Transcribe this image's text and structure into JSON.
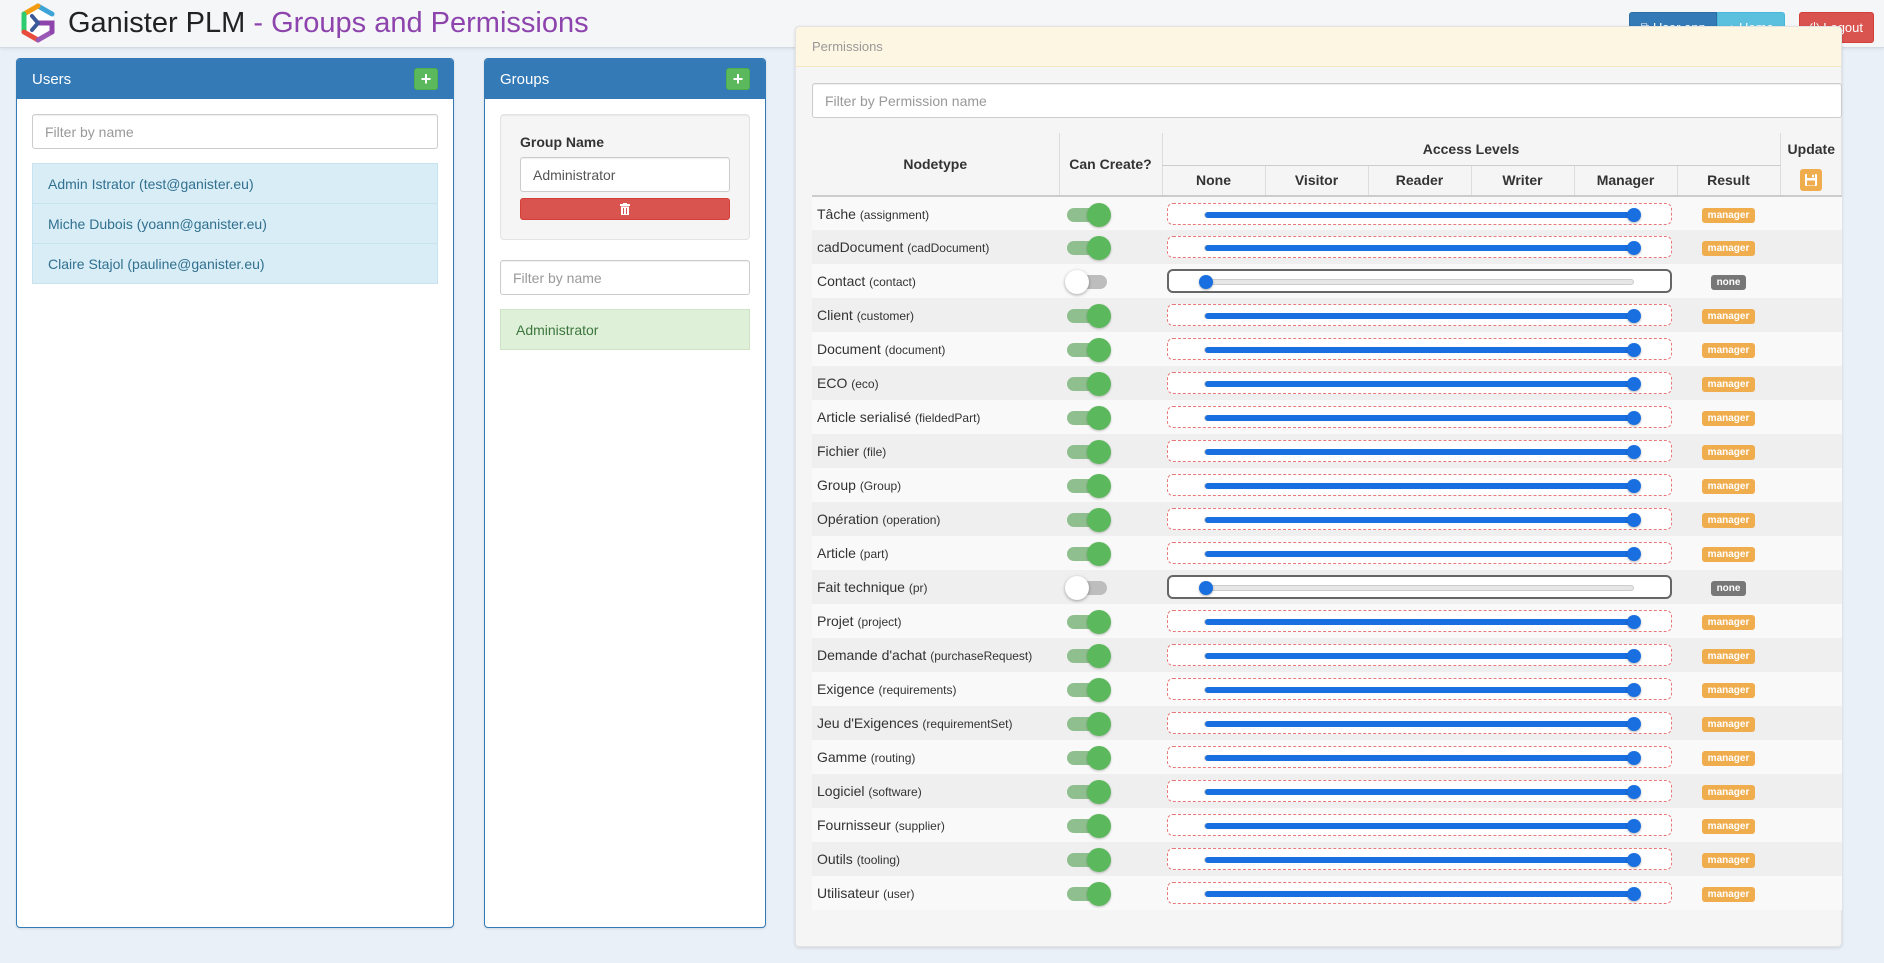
{
  "header": {
    "app_name": "Ganister PLM",
    "separator": " - ",
    "page_title": "Groups and Permissions",
    "buttons": {
      "user_app": "User app",
      "home": "Home",
      "logout": "Logout"
    }
  },
  "users_panel": {
    "title": "Users",
    "filter_placeholder": "Filter by name",
    "users": [
      "Admin Istrator (test@ganister.eu)",
      "Miche Dubois (yoann@ganister.eu)",
      "Claire Stajol (pauline@ganister.eu)"
    ]
  },
  "groups_panel": {
    "title": "Groups",
    "group_name_label": "Group Name",
    "group_name_value": "Administrator",
    "filter_placeholder": "Filter by name",
    "groups": [
      "Administrator"
    ]
  },
  "permissions_panel": {
    "title": "Permissions",
    "filter_placeholder": "Filter by Permission name",
    "headers": {
      "nodetype": "Nodetype",
      "can_create": "Can Create?",
      "access_levels": "Access Levels",
      "update": "Update",
      "result": "Result",
      "levels": [
        "None",
        "Visitor",
        "Reader",
        "Writer",
        "Manager"
      ]
    },
    "rows": [
      {
        "name": "Tâche",
        "code": "(assignment)",
        "can_create": true,
        "level": 4,
        "result": "manager"
      },
      {
        "name": "cadDocument",
        "code": "(cadDocument)",
        "can_create": true,
        "level": 4,
        "result": "manager"
      },
      {
        "name": "Contact",
        "code": "(contact)",
        "can_create": false,
        "level": 0,
        "result": "none"
      },
      {
        "name": "Client",
        "code": "(customer)",
        "can_create": true,
        "level": 4,
        "result": "manager"
      },
      {
        "name": "Document",
        "code": "(document)",
        "can_create": true,
        "level": 4,
        "result": "manager"
      },
      {
        "name": "ECO",
        "code": "(eco)",
        "can_create": true,
        "level": 4,
        "result": "manager"
      },
      {
        "name": "Article serialisé",
        "code": "(fieldedPart)",
        "can_create": true,
        "level": 4,
        "result": "manager"
      },
      {
        "name": "Fichier",
        "code": "(file)",
        "can_create": true,
        "level": 4,
        "result": "manager"
      },
      {
        "name": "Group",
        "code": "(Group)",
        "can_create": true,
        "level": 4,
        "result": "manager"
      },
      {
        "name": "Opération",
        "code": "(operation)",
        "can_create": true,
        "level": 4,
        "result": "manager"
      },
      {
        "name": "Article",
        "code": "(part)",
        "can_create": true,
        "level": 4,
        "result": "manager"
      },
      {
        "name": "Fait technique",
        "code": "(pr)",
        "can_create": false,
        "level": 0,
        "result": "none"
      },
      {
        "name": "Projet",
        "code": "(project)",
        "can_create": true,
        "level": 4,
        "result": "manager"
      },
      {
        "name": "Demande d'achat",
        "code": "(purchaseRequest)",
        "can_create": true,
        "level": 4,
        "result": "manager"
      },
      {
        "name": "Exigence",
        "code": "(requirements)",
        "can_create": true,
        "level": 4,
        "result": "manager"
      },
      {
        "name": "Jeu d'Exigences",
        "code": "(requirementSet)",
        "can_create": true,
        "level": 4,
        "result": "manager"
      },
      {
        "name": "Gamme",
        "code": "(routing)",
        "can_create": true,
        "level": 4,
        "result": "manager"
      },
      {
        "name": "Logiciel",
        "code": "(software)",
        "can_create": true,
        "level": 4,
        "result": "manager"
      },
      {
        "name": "Fournisseur",
        "code": "(supplier)",
        "can_create": true,
        "level": 4,
        "result": "manager"
      },
      {
        "name": "Outils",
        "code": "(tooling)",
        "can_create": true,
        "level": 4,
        "result": "manager"
      },
      {
        "name": "Utilisateur",
        "code": "(user)",
        "can_create": true,
        "level": 4,
        "result": "manager"
      }
    ]
  },
  "icons": {
    "logo": "ganister-logo",
    "user_app": "external-link-icon",
    "home": "home-icon",
    "logout": "power-icon",
    "add": "plus-icon",
    "delete": "trash-icon",
    "save": "floppy-disk-icon"
  },
  "colors": {
    "primary": "#337ab7",
    "info": "#5bc0de",
    "danger": "#d9534f",
    "success": "#5cb85c",
    "warning": "#f0ad4e",
    "slider": "#1a6fe0",
    "title_accent": "#8e44ad"
  }
}
